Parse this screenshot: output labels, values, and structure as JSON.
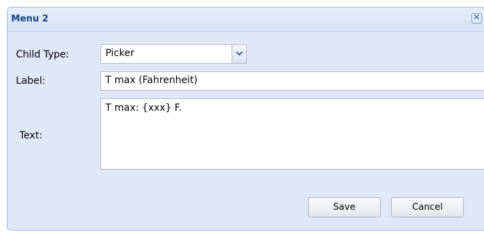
{
  "dialog": {
    "title": "Menu 2",
    "close_icon": "close-icon",
    "close_symbol": "✕"
  },
  "form": {
    "child_type_label": "Child Type:",
    "child_type_value": "Picker",
    "label_label": "Label:",
    "label_value": "T max (Fahrenheit)",
    "text_label": "Text:",
    "text_value": "T max: {xxx} F."
  },
  "buttons": {
    "save": "Save",
    "cancel": "Cancel"
  },
  "colors": {
    "panel_bg": "#dfe8f6",
    "title_text": "#15428b",
    "border": "#99bbe8"
  }
}
